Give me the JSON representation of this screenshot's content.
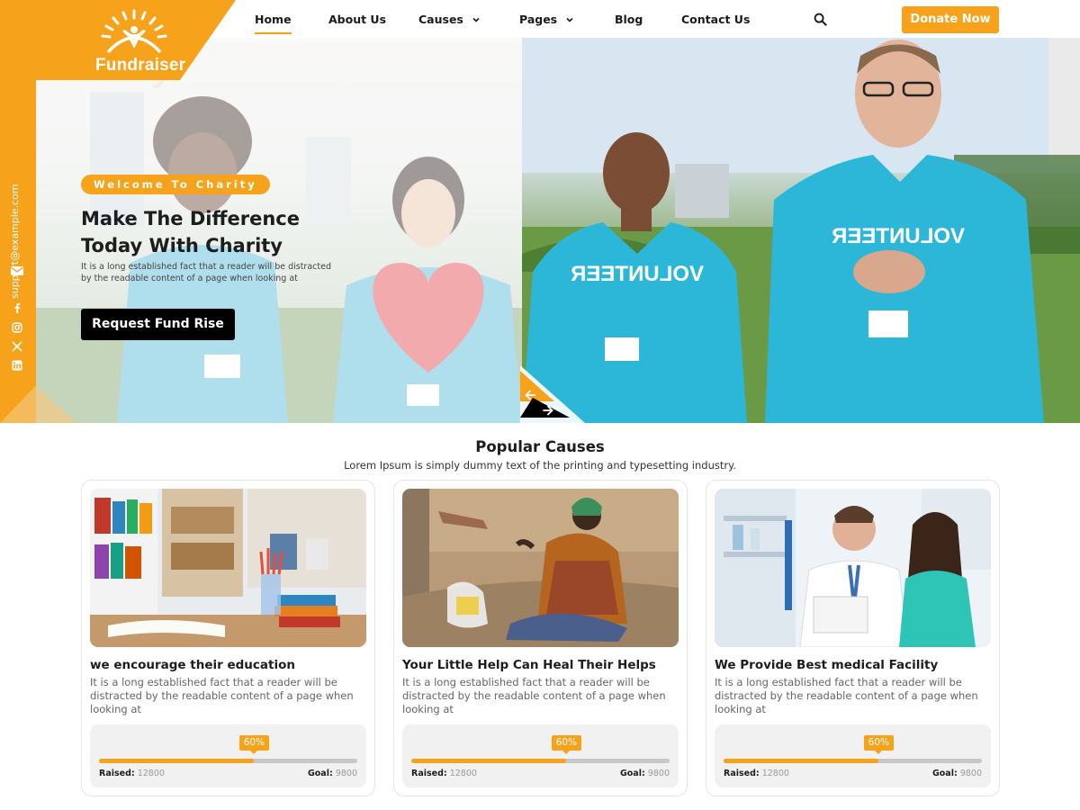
{
  "brand": {
    "name": "Fundraiser",
    "accent": "#f7a21b",
    "dark": "#000000"
  },
  "nav": {
    "items": [
      {
        "label": "Home",
        "active": true,
        "dropdown": false
      },
      {
        "label": "About Us",
        "active": false,
        "dropdown": false
      },
      {
        "label": "Causes",
        "active": false,
        "dropdown": true
      },
      {
        "label": "Pages",
        "active": false,
        "dropdown": true
      },
      {
        "label": "Blog",
        "active": false,
        "dropdown": false
      },
      {
        "label": "Contact Us",
        "active": false,
        "dropdown": false
      }
    ],
    "search_icon": "search-icon",
    "donate_label": "Donate Now"
  },
  "sidebar": {
    "email": "support@example.com",
    "mail_icon": "mail-icon",
    "social": [
      "facebook-icon",
      "instagram-icon",
      "x-icon",
      "linkedin-icon"
    ]
  },
  "hero": {
    "watermark": "Charity",
    "badge": "Welcome To Charity",
    "title_line1": "Make The Difference",
    "title_line2": "Today With Charity",
    "description": "It is a long established fact that a reader will be distracted by the readable content of a page when looking at",
    "cta_label": "Request Fund Rise",
    "left_shirt_text": "VOLUNTEER",
    "right_shirt_text": "VOLUNTEER"
  },
  "causes": {
    "title": "Popular Causes",
    "subtitle": "Lorem Ipsum is simply dummy text of the printing and typesetting industry.",
    "cards": [
      {
        "title": "we encourage their education",
        "text": "It is a long established fact that a reader will be distracted by the readable content of a page when looking at",
        "percent": 60,
        "percent_label": "60%",
        "raised_label": "Raised:",
        "raised": "12800",
        "goal_label": "Goal:",
        "goal": "9800"
      },
      {
        "title": "Your Little Help Can Heal Their Helps",
        "text": "It is a long established fact that a reader will be distracted by the readable content of a page when looking at",
        "percent": 60,
        "percent_label": "60%",
        "raised_label": "Raised:",
        "raised": "12800",
        "goal_label": "Goal:",
        "goal": "9800"
      },
      {
        "title": "We Provide Best medical Facility",
        "text": "It is a long established fact that a reader will be distracted by the readable content of a page when looking at",
        "percent": 60,
        "percent_label": "60%",
        "raised_label": "Raised:",
        "raised": "12800",
        "goal_label": "Goal:",
        "goal": "9800"
      }
    ]
  }
}
